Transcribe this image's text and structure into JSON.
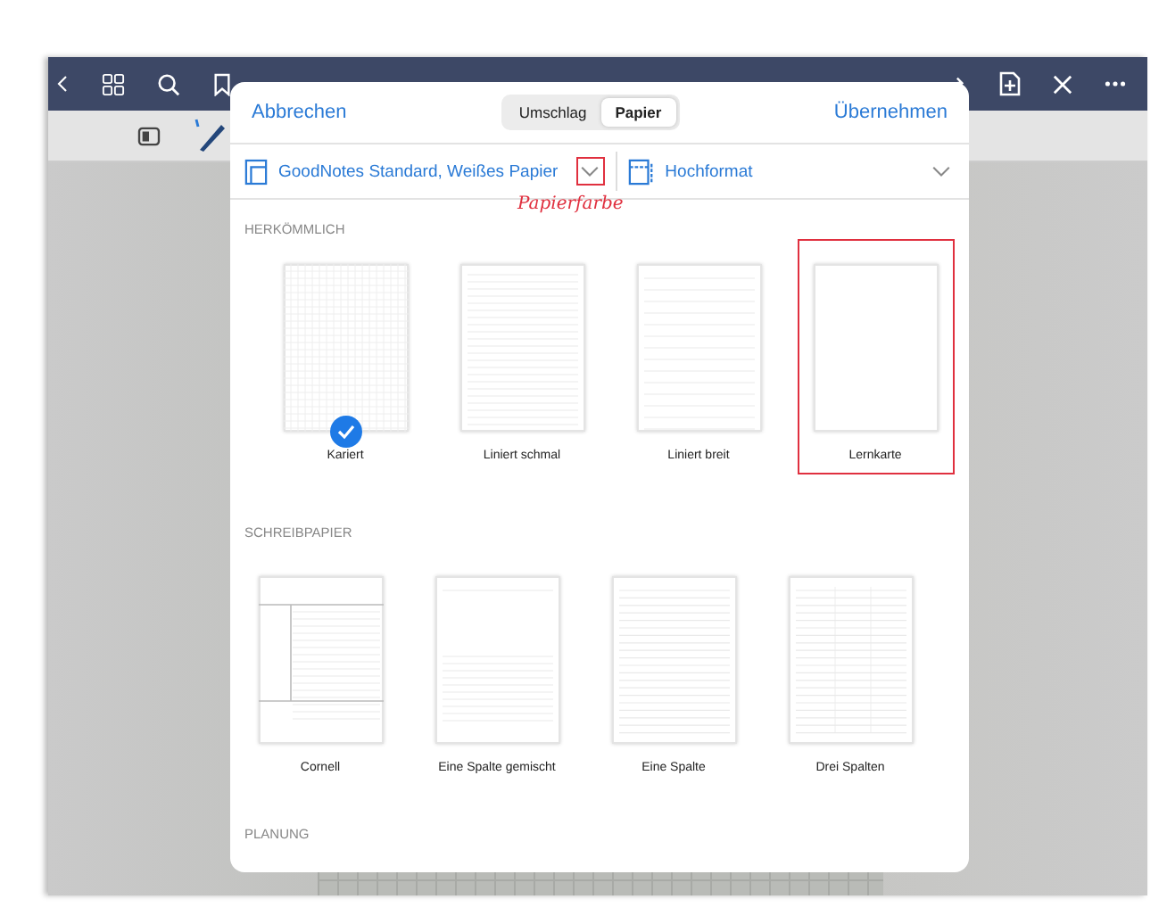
{
  "dialog": {
    "cancel": "Abbrechen",
    "apply": "Übernehmen",
    "segments": [
      {
        "label": "Umschlag",
        "selected": false
      },
      {
        "label": "Papier",
        "selected": true
      }
    ],
    "paper": {
      "name": "GoodNotes Standard, Weißes Papier",
      "orientation": "Hochformat"
    },
    "sections": [
      {
        "title": "HERKÖMMLICH",
        "templates": [
          {
            "label": "Kariert",
            "kind": "grid",
            "selected": true,
            "highlighted": false
          },
          {
            "label": "Liniert schmal",
            "kind": "lined-narrow",
            "selected": false,
            "highlighted": false
          },
          {
            "label": "Liniert breit",
            "kind": "lined-wide",
            "selected": false,
            "highlighted": false
          },
          {
            "label": "Lernkarte",
            "kind": "blank",
            "selected": false,
            "highlighted": true
          }
        ]
      },
      {
        "title": "SCHREIBPAPIER",
        "templates": [
          {
            "label": "Cornell",
            "kind": "cornell",
            "selected": false,
            "highlighted": false
          },
          {
            "label": "Eine Spalte gemischt",
            "kind": "mixed",
            "selected": false,
            "highlighted": false
          },
          {
            "label": "Eine Spalte",
            "kind": "single-column",
            "selected": false,
            "highlighted": false
          },
          {
            "label": "Drei Spalten",
            "kind": "three-columns",
            "selected": false,
            "highlighted": false
          }
        ]
      },
      {
        "title": "PLANUNG"
      }
    ]
  },
  "annotation": {
    "text": "Papierfarbe"
  }
}
